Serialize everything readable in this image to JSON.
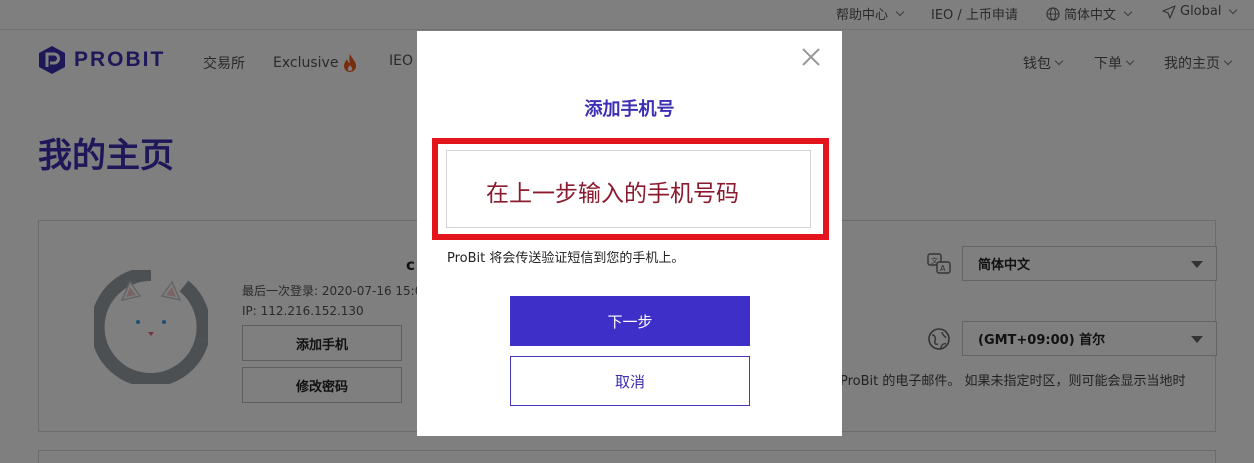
{
  "topbar": {
    "help": "帮助中心",
    "ieo": "IEO / 上币申请",
    "language": "简体中文",
    "region": "Global"
  },
  "nav": {
    "logo": "PROBIT",
    "exchange": "交易所",
    "exclusive": "Exclusive",
    "ieo": "IEO",
    "wallet": "钱包",
    "order": "下单",
    "my_page": "我的主页"
  },
  "page": {
    "title": "我的主页"
  },
  "profile": {
    "username_tail": "c",
    "last_login": "最后一次登录: 2020-07-16 15:01",
    "ip": "IP: 112.216.152.130",
    "add_phone_button": "添加手机",
    "change_password_button": "修改密码"
  },
  "preferences": {
    "language_value": "简体中文",
    "timezone_value": "(GMT+09:00) 首尔",
    "timezone_note": "ProBit 的电子邮件。 如果未指定时区，则可能会显示当地时"
  },
  "modal": {
    "title": "添加手机号",
    "phone_annotation": "在上一步输入的手机号码",
    "hint": "ProBit 将会传送验证短信到您的手机上。",
    "next_button": "下一步",
    "cancel_button": "取消"
  },
  "colors": {
    "brand": "#3d2fb5",
    "primary_button": "#3d2fc8",
    "highlight_border": "#e3141c",
    "annotation_text": "#8b1a2e"
  },
  "icons": [
    "chevron-down-icon",
    "globe-icon",
    "location-arrow-icon",
    "probit-logo-icon",
    "flame-icon",
    "cat-avatar",
    "translate-icon",
    "timezone-globe-icon",
    "close-icon",
    "dropdown-caret-icon"
  ]
}
